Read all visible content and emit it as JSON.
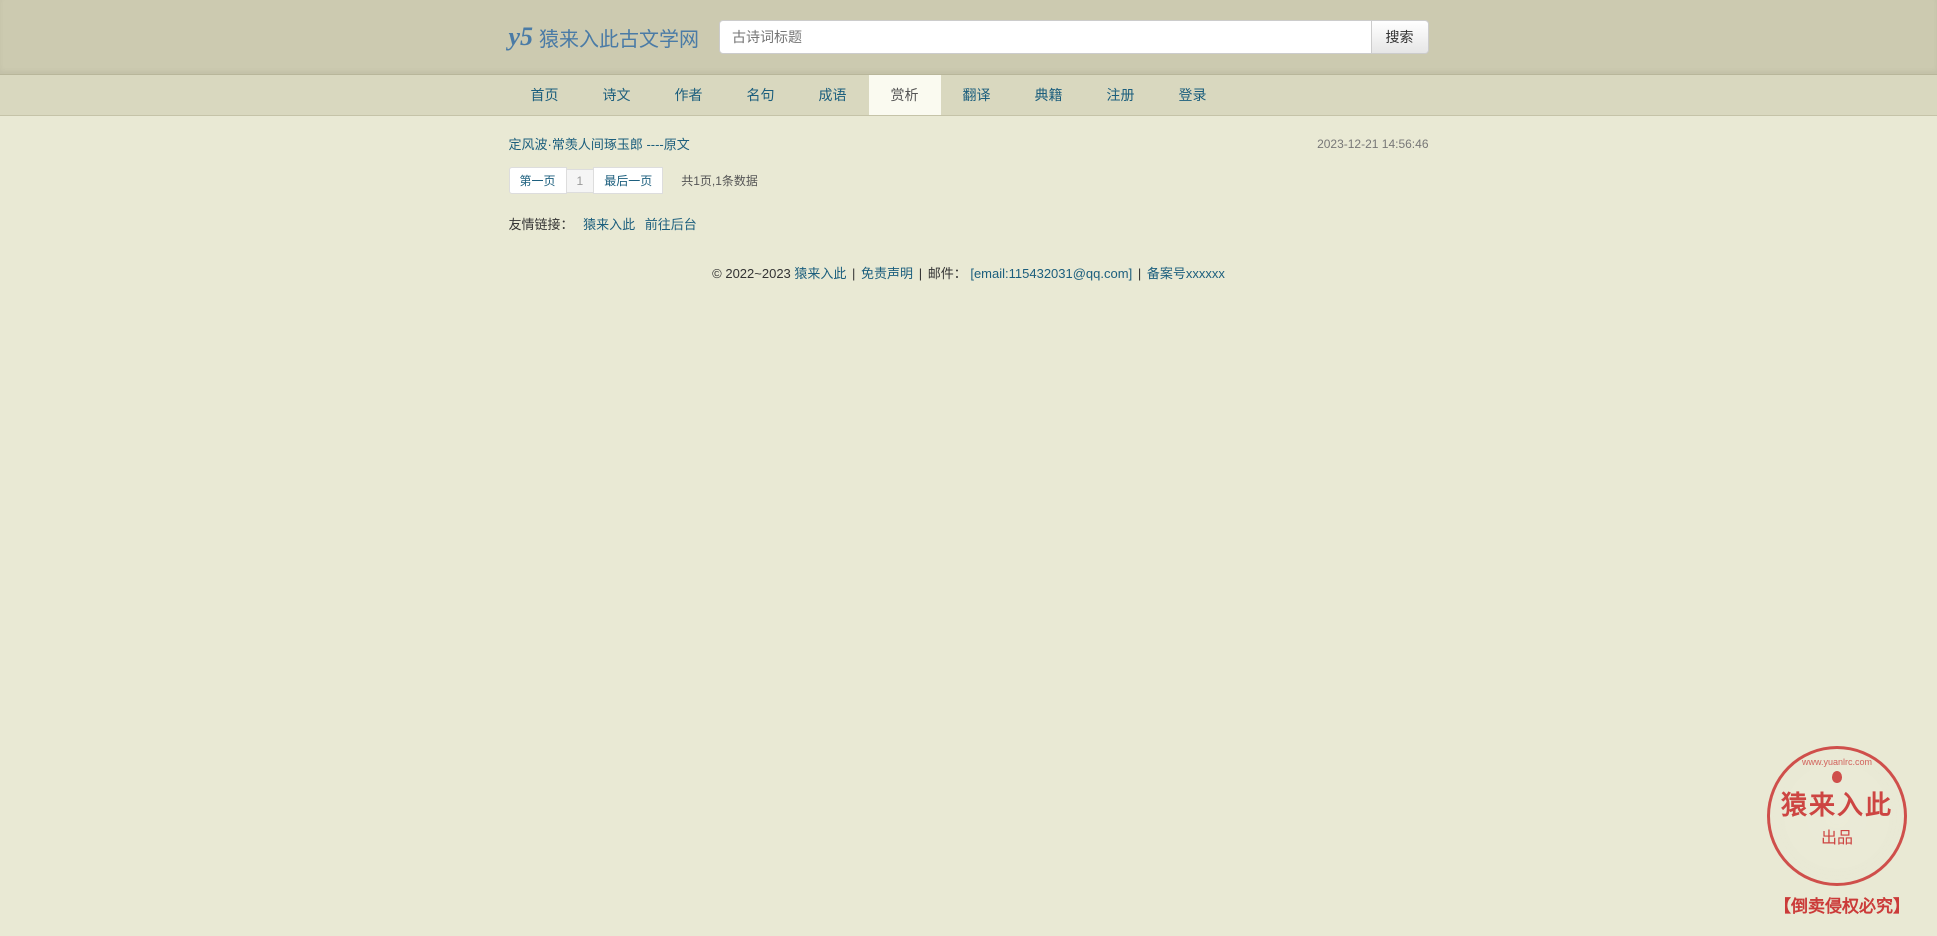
{
  "header": {
    "site_name": "猿来入此古文学网",
    "search_placeholder": "古诗词标题",
    "search_button": "搜索"
  },
  "nav": {
    "items": [
      {
        "label": "首页"
      },
      {
        "label": "诗文"
      },
      {
        "label": "作者"
      },
      {
        "label": "名句"
      },
      {
        "label": "成语"
      },
      {
        "label": "赏析"
      },
      {
        "label": "翻译"
      },
      {
        "label": "典籍"
      },
      {
        "label": "注册"
      },
      {
        "label": "登录"
      }
    ],
    "active_index": 5
  },
  "articles": [
    {
      "title": "定风波·常羡人间琢玉郎 ----原文",
      "date": "2023-12-21 14:56:46"
    }
  ],
  "pagination": {
    "first": "第一页",
    "current": "1",
    "last": "最后一页",
    "info": "共1页,1条数据"
  },
  "friend": {
    "label": "友情链接：",
    "links": [
      {
        "text": "猿来入此"
      },
      {
        "text": "前往后台"
      }
    ]
  },
  "footer": {
    "copyright": "© 2022~2023 ",
    "site_link": "猿来入此",
    "disclaimer": "免责声明",
    "mail_label": "邮件：",
    "email": "[email:115432031@qq.com]",
    "beian": "备案号xxxxxx"
  },
  "stamp": {
    "arc": "www.yuanlrc.com",
    "main": "猿来入此",
    "sub": "出品",
    "bottom": "【倒卖侵权必究】"
  }
}
